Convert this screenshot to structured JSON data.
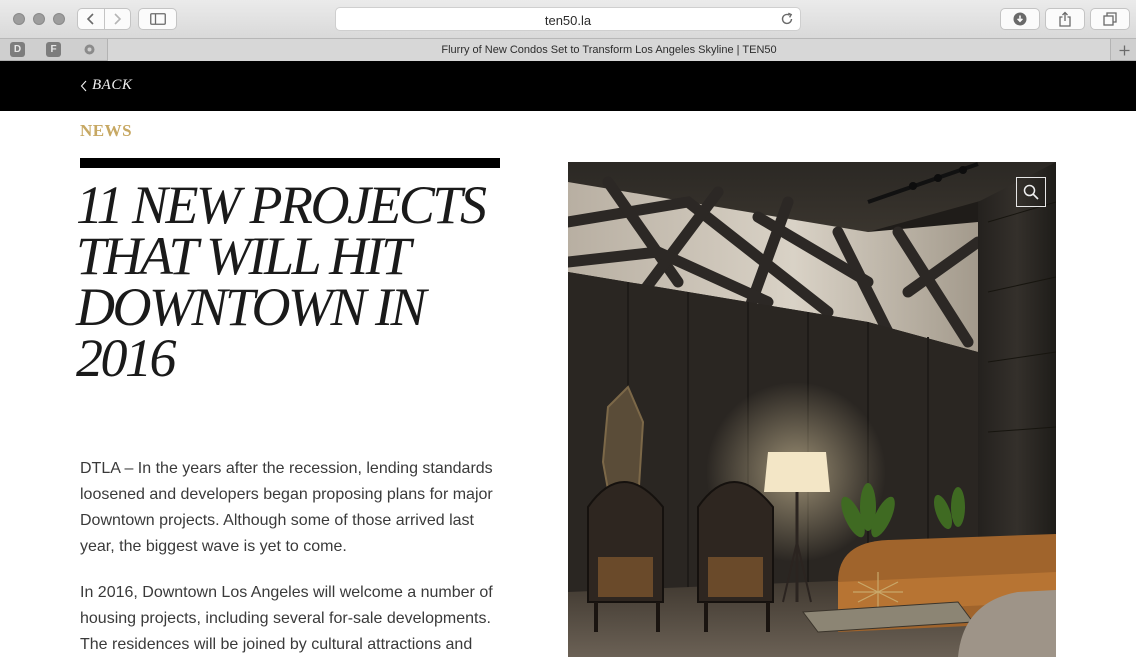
{
  "browser": {
    "url": "ten50.la",
    "tab_title": "Flurry of New Condos Set to Transform Los Angeles Skyline | TEN50",
    "pinned_tabs": [
      "D",
      "F"
    ]
  },
  "site": {
    "back_label": "BACK"
  },
  "article": {
    "category": "NEWS",
    "headline": "11 New Projects That Will Hit Downtown in 2016",
    "paragraphs": [
      "DTLA – In the years after the recession, lending standards loosened and developers began proposing plans for major Downtown projects. Although some of those arrived last year, the biggest wave is yet to come.",
      "In 2016, Downtown Los Angeles will welcome a number of housing projects, including several for-sale developments. The residences will be joined by cultural attractions and"
    ]
  },
  "icons": {
    "back": "chevron-left-icon",
    "zoom": "search-icon",
    "reload": "reload-icon",
    "download": "download-icon",
    "share": "share-icon",
    "tabs": "tabs-icon",
    "sidebar": "sidebar-icon",
    "new_tab": "plus-icon"
  },
  "colors": {
    "accent_gold": "#c7a863",
    "header_bg": "#000000",
    "text": "#3a3a3a"
  }
}
